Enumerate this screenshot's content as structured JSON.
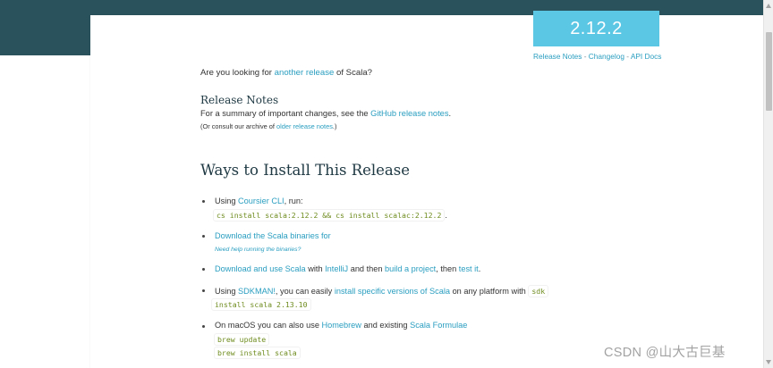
{
  "version": {
    "number": "2.12.2",
    "links": [
      "Release Notes",
      "Changelog",
      "API Docs"
    ],
    "separator": " - "
  },
  "intro": {
    "before": "Are you looking for ",
    "link": "another release",
    "after": " of Scala?"
  },
  "release_notes": {
    "heading": "Release Notes",
    "summary_before": "For a summary of important changes, see the ",
    "summary_link": "GitHub release notes",
    "summary_after": ".",
    "archive_before": "(Or consult our archive of ",
    "archive_link": "older release notes",
    "archive_after": ".)"
  },
  "ways": {
    "heading": "Ways to Install This Release",
    "coursier": {
      "before": "Using ",
      "link": "Coursier CLI",
      "after": ", run:",
      "code": "cs install scala:2.12.2 && cs install scalac:2.12.2",
      "after_code": "."
    },
    "download": {
      "link": "Download the Scala binaries for",
      "help": "Need help running the binaries?"
    },
    "intellij": {
      "link1": "Download and use Scala",
      "text1": " with ",
      "link2": "IntelliJ",
      "text2": " and then ",
      "link3": "build a project",
      "text3": ", then ",
      "link4": "test it",
      "text4": "."
    },
    "sdkman": {
      "before": "Using ",
      "link1": "SDKMAN!",
      "text1": ", you can easily ",
      "link2": "install specific versions of Scala",
      "text2": " on any platform with ",
      "code1": "sdk",
      "code2": "install scala 2.13.10"
    },
    "homebrew": {
      "before": "On macOS you can also use ",
      "link1": "Homebrew",
      "text1": " and existing ",
      "link2": "Scala Formulae",
      "code1": "brew update",
      "code2": "brew install scala"
    }
  },
  "watermark": "CSDN @山大古巨基",
  "colors": {
    "header_band": "#2a525c",
    "version_box": "#5cc6e5",
    "link": "#2a9ec0",
    "code": "#6f8c1f"
  }
}
